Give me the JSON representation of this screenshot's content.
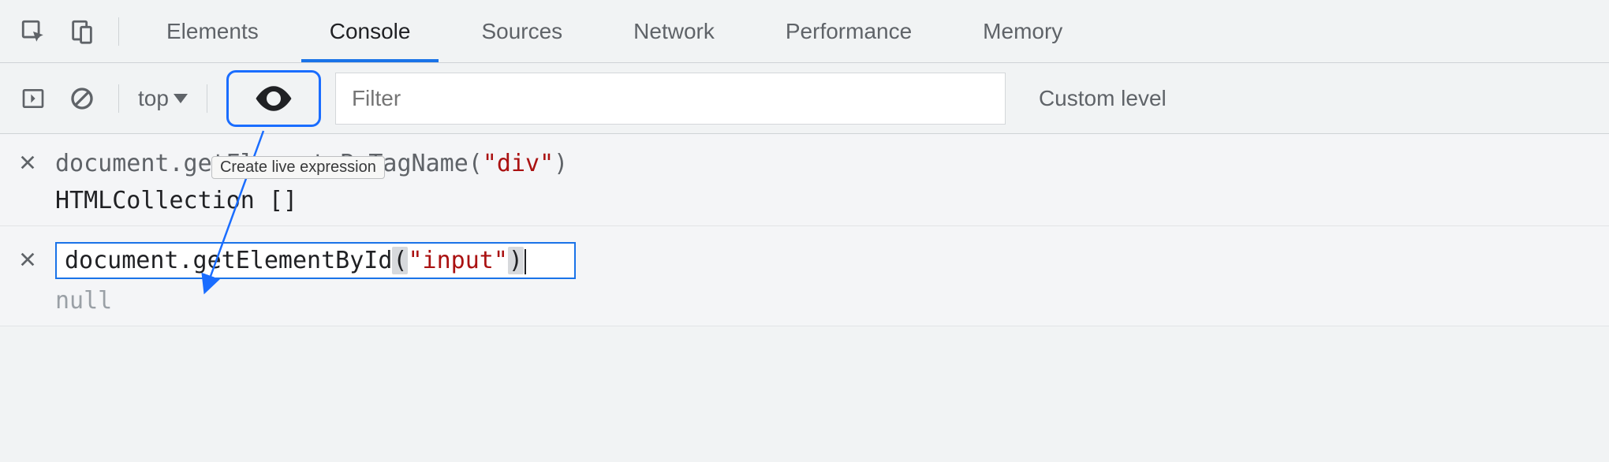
{
  "tabs": {
    "elements": "Elements",
    "console": "Console",
    "sources": "Sources",
    "network": "Network",
    "performance": "Performance",
    "memory": "Memory"
  },
  "toolbar": {
    "context": "top",
    "filter_placeholder": "Filter",
    "levels": "Custom level",
    "tooltip": "Create live expression"
  },
  "expr1": {
    "call_pre": "document.getElementsByTagName(",
    "arg": "\"div\"",
    "call_post": ")",
    "result": "HTMLCollection []"
  },
  "expr2": {
    "call_pre": "document.getElementById",
    "open": "(",
    "arg": "\"input\"",
    "close": ")",
    "result": "null"
  }
}
